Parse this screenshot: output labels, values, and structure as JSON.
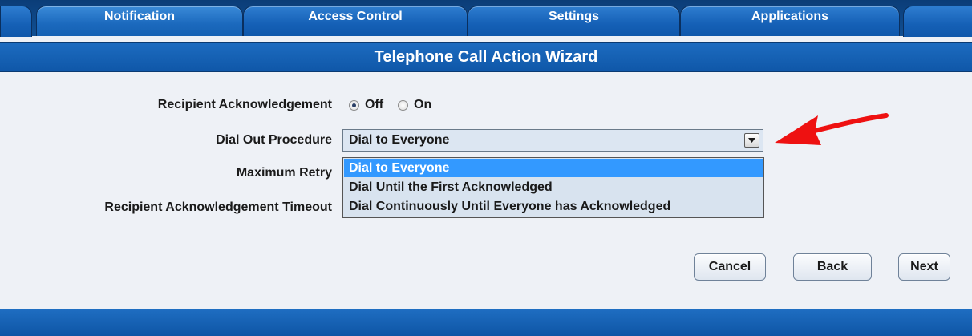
{
  "tabs": [
    {
      "label": "Notification",
      "active": true
    },
    {
      "label": "Access Control",
      "active": false
    },
    {
      "label": "Settings",
      "active": false
    },
    {
      "label": "Applications",
      "active": false
    }
  ],
  "wizard": {
    "title": "Telephone Call Action Wizard"
  },
  "form": {
    "ack_label": "Recipient Acknowledgement",
    "ack_options": [
      {
        "label": "Off",
        "checked": true
      },
      {
        "label": "On",
        "checked": false
      }
    ],
    "dial_label": "Dial Out Procedure",
    "dial_value": "Dial to Everyone",
    "dial_options": [
      {
        "label": "Dial to Everyone",
        "selected": true
      },
      {
        "label": "Dial Until the First Acknowledged",
        "selected": false
      },
      {
        "label": "Dial Continuously Until Everyone has Acknowledged",
        "selected": false
      }
    ],
    "retry_label": "Maximum Retry",
    "timeout_label": "Recipient Acknowledgement Timeout"
  },
  "buttons": {
    "cancel": "Cancel",
    "back": "Back",
    "next": "Next"
  },
  "colors": {
    "header_blue": "#1560b6",
    "highlight": "#3399ff",
    "arrow": "#ee1111"
  },
  "icons": {
    "dropdown": "chevron-down-icon",
    "annotation": "red-arrow-icon"
  }
}
